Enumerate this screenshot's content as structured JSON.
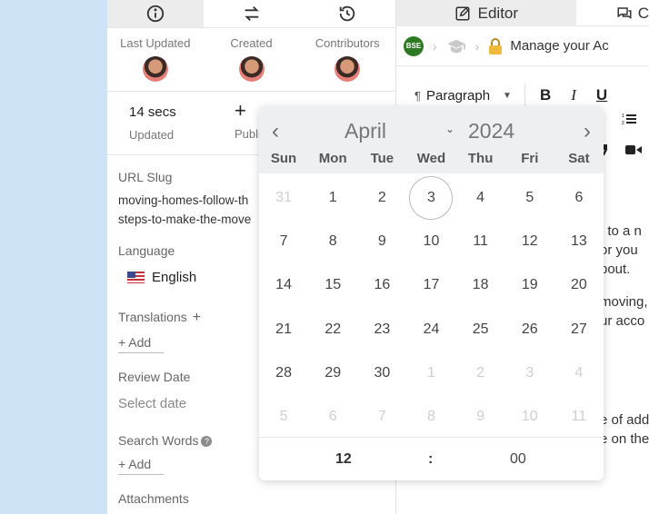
{
  "panel": {
    "meta": [
      {
        "label": "Last Updated"
      },
      {
        "label": "Created"
      },
      {
        "label": "Contributors"
      }
    ],
    "stats": {
      "updated_value": "14 secs",
      "updated_label": "Updated",
      "publish_label": "Publis"
    },
    "url_slug": {
      "label": "URL Slug",
      "line1": "moving-homes-follow-th",
      "line2": "steps-to-make-the-move"
    },
    "language": {
      "label": "Language",
      "value": "English"
    },
    "translations": {
      "label": "Translations",
      "add": "+ Add"
    },
    "review_date": {
      "label": "Review Date",
      "placeholder": "Select date"
    },
    "search_words": {
      "label": "Search Words",
      "add": "+ Add"
    },
    "attachments": {
      "label": "Attachments"
    }
  },
  "editor": {
    "tab_editor": "Editor",
    "tab_other": "C",
    "breadcrumb_badge": "BSE",
    "breadcrumb_text": "Manage your Ac",
    "toolbar": {
      "paragraph": "Paragraph",
      "bold": "B",
      "italic": "I",
      "underline": "U"
    },
    "text_lines": [
      "t to a n",
      "or you",
      "bout.",
      "moving,",
      "ur acco",
      "e of add",
      "e on the"
    ]
  },
  "calendar": {
    "month": "April",
    "year": "2024",
    "weekdays": [
      "Sun",
      "Mon",
      "Tue",
      "Wed",
      "Thu",
      "Fri",
      "Sat"
    ],
    "weeks": [
      [
        "31",
        "1",
        "2",
        "3",
        "4",
        "5",
        "6"
      ],
      [
        "7",
        "8",
        "9",
        "10",
        "11",
        "12",
        "13"
      ],
      [
        "14",
        "15",
        "16",
        "17",
        "18",
        "19",
        "20"
      ],
      [
        "21",
        "22",
        "23",
        "24",
        "25",
        "26",
        "27"
      ],
      [
        "28",
        "29",
        "30",
        "1",
        "2",
        "3",
        "4"
      ],
      [
        "5",
        "6",
        "7",
        "8",
        "9",
        "10",
        "11"
      ]
    ],
    "today": "3",
    "time": {
      "hour": "12",
      "separator": ":",
      "minute": "00"
    }
  }
}
